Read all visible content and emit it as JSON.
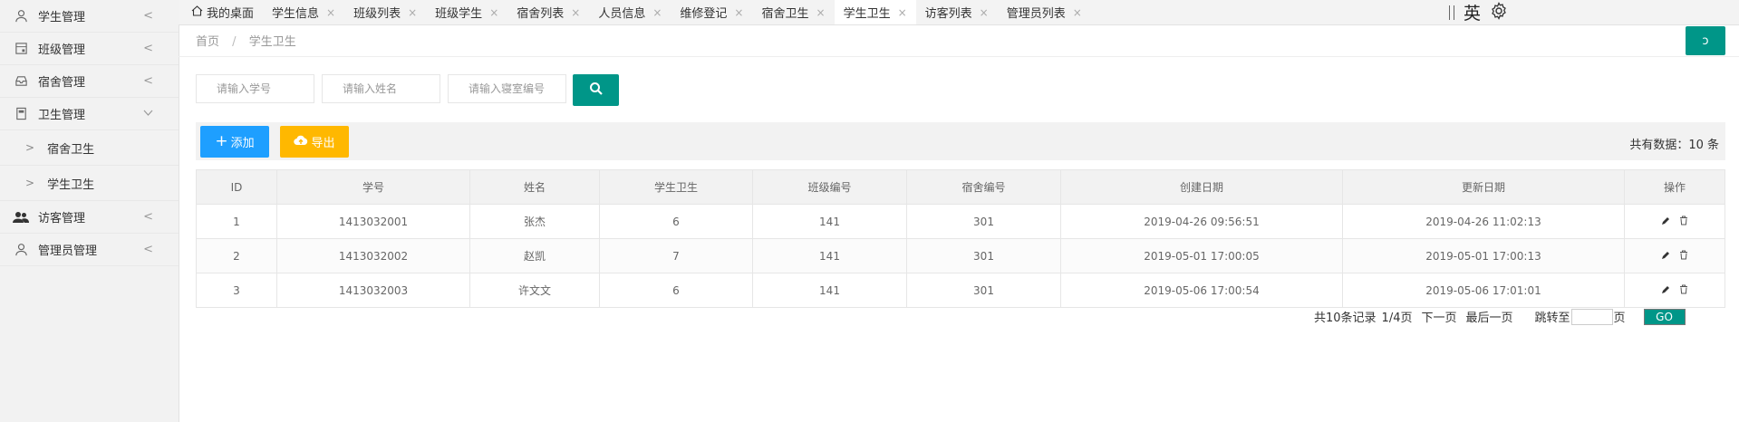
{
  "sidebar": {
    "items": [
      {
        "label": "学生管理",
        "icon": "user-icon",
        "arrow": "<"
      },
      {
        "label": "班级管理",
        "icon": "calendar-icon",
        "arrow": "<"
      },
      {
        "label": "宿舍管理",
        "icon": "inbox-icon",
        "arrow": "<"
      },
      {
        "label": "卫生管理",
        "icon": "document-icon",
        "arrow": "v"
      },
      {
        "label": "宿舍卫生",
        "icon": "chevron-right-icon"
      },
      {
        "label": "学生卫生",
        "icon": "chevron-right-icon"
      },
      {
        "label": "访客管理",
        "icon": "group-icon",
        "arrow": "<"
      },
      {
        "label": "管理员管理",
        "icon": "user-icon",
        "arrow": "<"
      }
    ]
  },
  "tabs": {
    "items": [
      {
        "label": "我的桌面",
        "icon": "home-icon"
      },
      {
        "label": "学生信息",
        "close": "×"
      },
      {
        "label": "班级列表",
        "close": "×"
      },
      {
        "label": "班级学生",
        "close": "×"
      },
      {
        "label": "宿舍列表",
        "close": "×"
      },
      {
        "label": "人员信息",
        "close": "×"
      },
      {
        "label": "维修登记",
        "close": "×"
      },
      {
        "label": "宿舍卫生",
        "close": "×"
      },
      {
        "label": "学生卫生",
        "close": "×",
        "active": true
      },
      {
        "label": "访客列表",
        "close": "×"
      },
      {
        "label": "管理员列表",
        "close": "×"
      }
    ]
  },
  "topbar": {
    "lang": "英",
    "settings_icon": "gear-icon"
  },
  "breadcrumb": {
    "home": "首页",
    "sep": "/",
    "current": "学生卫生"
  },
  "refresh_button": {
    "icon": "refresh-icon",
    "label": "ↄ"
  },
  "search": {
    "student_no_placeholder": "请输入学号",
    "name_placeholder": "请输入姓名",
    "dorm_no_placeholder": "请输入寝室编号",
    "button_icon": "search-icon"
  },
  "toolbar": {
    "add_label": "添加",
    "export_label": "导出",
    "total": "共有数据：10 条"
  },
  "table": {
    "headers": [
      "ID",
      "学号",
      "姓名",
      "学生卫生",
      "班级编号",
      "宿舍编号",
      "创建日期",
      "更新日期",
      "操作"
    ],
    "rows": [
      [
        "1",
        "1413032001",
        "张杰",
        "6",
        "141",
        "301",
        "2019-04-26 09:56:51",
        "2019-04-26 11:02:13"
      ],
      [
        "2",
        "1413032002",
        "赵凯",
        "7",
        "141",
        "301",
        "2019-05-01 17:00:05",
        "2019-05-01 17:00:13"
      ],
      [
        "3",
        "1413032003",
        "许文文",
        "6",
        "141",
        "301",
        "2019-05-06 17:00:54",
        "2019-05-06 17:01:01"
      ]
    ]
  },
  "pager": {
    "summary": "共10条记录",
    "page": "1/4页",
    "next": "下一页",
    "last": "最后一页",
    "jump_label": "跳转至",
    "page_suffix": "页",
    "go": "GO"
  },
  "colors": {
    "accent": "#009688",
    "add": "#1e9fff",
    "export": "#ffb800"
  }
}
